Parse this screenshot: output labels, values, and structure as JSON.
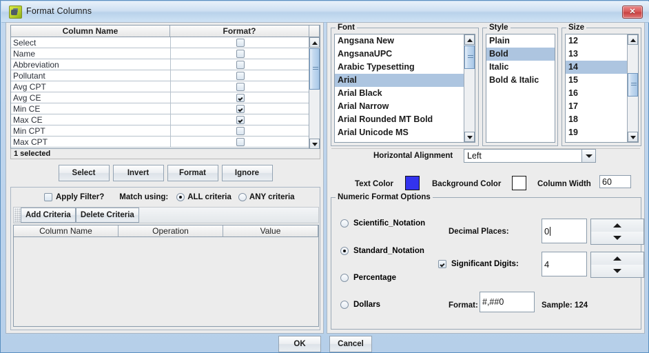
{
  "window": {
    "title": "Format Columns",
    "icon": "app-icon",
    "close_label": "✕"
  },
  "columns_table": {
    "headers": [
      "Column Name",
      "Format?"
    ],
    "rows": [
      {
        "name": "Select",
        "format": false
      },
      {
        "name": "Name",
        "format": false
      },
      {
        "name": "Abbreviation",
        "format": false
      },
      {
        "name": "Pollutant",
        "format": false
      },
      {
        "name": "Avg CPT",
        "format": false
      },
      {
        "name": "Avg CE",
        "format": true
      },
      {
        "name": "Min CE",
        "format": true
      },
      {
        "name": "Max CE",
        "format": true
      },
      {
        "name": "Min CPT",
        "format": false
      },
      {
        "name": "Max CPT",
        "format": false
      }
    ],
    "status": "1 selected"
  },
  "row_buttons": [
    {
      "label": "Select"
    },
    {
      "label": "Invert"
    },
    {
      "label": "Format"
    },
    {
      "label": "Ignore"
    }
  ],
  "filter": {
    "apply_filter_label": "Apply Filter?",
    "apply_filter_checked": false,
    "match_using_label": "Match using:",
    "options": [
      {
        "label": "ALL criteria",
        "selected": true
      },
      {
        "label": "ANY criteria",
        "selected": false
      }
    ],
    "toolbar": [
      {
        "label": "Add Criteria"
      },
      {
        "label": "Delete Criteria"
      }
    ],
    "criteria_headers": [
      "Column Name",
      "Operation",
      "Value"
    ],
    "criteria_rows": []
  },
  "font_group": {
    "title": "Font",
    "items": [
      "Angsana New",
      "AngsanaUPC",
      "Arabic Typesetting",
      "Arial",
      "Arial Black",
      "Arial Narrow",
      "Arial Rounded MT Bold",
      "Arial Unicode MS"
    ],
    "selected": "Arial"
  },
  "style_group": {
    "title": "Style",
    "items": [
      "Plain",
      "Bold",
      "Italic",
      "Bold & Italic"
    ],
    "selected": "Bold"
  },
  "size_group": {
    "title": "Size",
    "items": [
      "12",
      "13",
      "14",
      "15",
      "16",
      "17",
      "18",
      "19"
    ],
    "selected": "14"
  },
  "alignment": {
    "label": "Horizontal Alignment",
    "value": "Left"
  },
  "colors": {
    "text_color_label": "Text Color",
    "text_color": "#3333ee",
    "background_color_label": "Background Color",
    "background_color": "#ffffff",
    "column_width_label": "Column Width",
    "column_width_value": "60"
  },
  "numeric": {
    "title": "Numeric Format Options",
    "radios": [
      {
        "label": "Scientific_Notation",
        "selected": false
      },
      {
        "label": "Standard_Notation",
        "selected": true
      },
      {
        "label": "Percentage",
        "selected": false
      },
      {
        "label": "Dollars",
        "selected": false
      }
    ],
    "decimal_places_label": "Decimal Places:",
    "decimal_places_value": "0",
    "significant_digits_label": "Significant Digits:",
    "significant_digits_checked": true,
    "significant_digits_value": "4",
    "format_label": "Format:",
    "format_value": "#,##0",
    "sample_label": "Sample: 124"
  },
  "dialog_buttons": [
    {
      "label": "OK"
    },
    {
      "label": "Cancel"
    }
  ]
}
